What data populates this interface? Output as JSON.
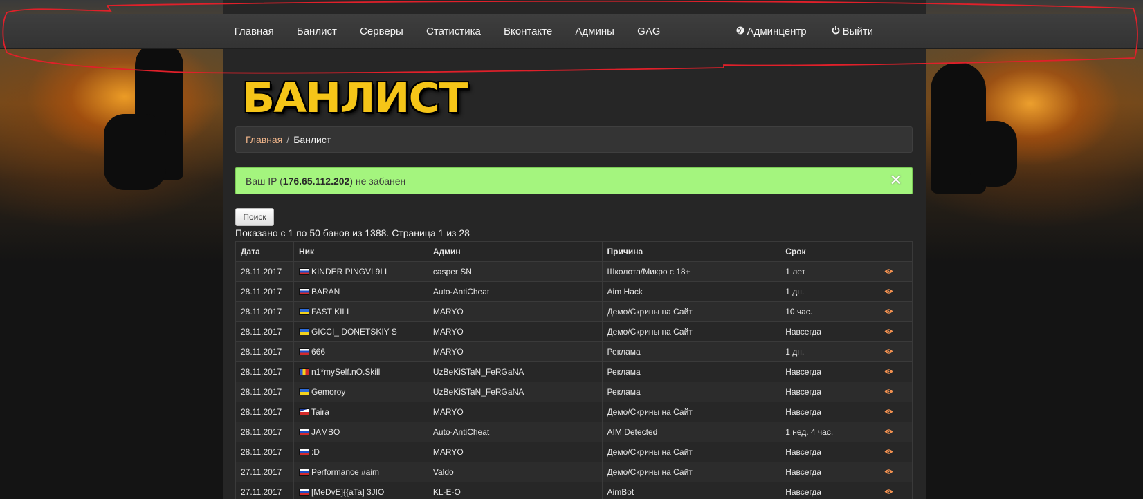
{
  "nav": {
    "links": [
      "Главная",
      "Банлист",
      "Серверы",
      "Статистика",
      "Вконтакте",
      "Админы",
      "GAG"
    ],
    "admin_center": "Админцентр",
    "logout": "Выйти"
  },
  "logo_text": "БАНЛИСТ",
  "breadcrumb": {
    "home": "Главная",
    "separator": "/",
    "current": "Банлист"
  },
  "alert": {
    "prefix": "Ваш IP (",
    "ip": "176.65.112.202",
    "suffix": ") не забанен",
    "close": "✕"
  },
  "search_button": "Поиск",
  "summary": "Показано с 1 по 50 банов из 1388. Страница 1 из 28",
  "table": {
    "headers": [
      "Дата",
      "Ник",
      "Админ",
      "Причина",
      "Срок",
      ""
    ],
    "rows": [
      {
        "date": "28.11.2017",
        "flag": "ru",
        "nick": "KINDER PINGVI 9I L",
        "admin": "casper SN",
        "reason": "Школота/Микро с 18+",
        "term": "1 лет"
      },
      {
        "date": "28.11.2017",
        "flag": "ru",
        "nick": "BARAN",
        "admin": "Auto-AntiCheat",
        "reason": "Aim Hack",
        "term": "1 дн."
      },
      {
        "date": "28.11.2017",
        "flag": "ua",
        "nick": "FAST KILL",
        "admin": "MARYO",
        "reason": "Демо/Скрины на Сайт",
        "term": "10 час."
      },
      {
        "date": "28.11.2017",
        "flag": "ua",
        "nick": "GICCI_ DONETSKIY S",
        "admin": "MARYO",
        "reason": "Демо/Скрины на Сайт",
        "term": "Навсегда"
      },
      {
        "date": "28.11.2017",
        "flag": "ru",
        "nick": "666",
        "admin": "MARYO",
        "reason": "Реклама",
        "term": "1 дн."
      },
      {
        "date": "28.11.2017",
        "flag": "md",
        "nick": "n1*mySelf.nO.Skill",
        "admin": "UzBeKiSTaN_FeRGaNA",
        "reason": "Реклама",
        "term": "Навсегда"
      },
      {
        "date": "28.11.2017",
        "flag": "ua",
        "nick": "Gemoroy",
        "admin": "UzBeKiSTaN_FeRGaNA",
        "reason": "Реклама",
        "term": "Навсегда"
      },
      {
        "date": "28.11.2017",
        "flag": "cz",
        "nick": "Taira",
        "admin": "MARYO",
        "reason": "Демо/Скрины на Сайт",
        "term": "Навсегда"
      },
      {
        "date": "28.11.2017",
        "flag": "ru",
        "nick": "JAMBO",
        "admin": "Auto-AntiCheat",
        "reason": "AIM Detected",
        "term": "1 нед. 4 час."
      },
      {
        "date": "28.11.2017",
        "flag": "ru",
        "nick": ":D",
        "admin": "MARYO",
        "reason": "Демо/Скрины на Сайт",
        "term": "Навсегда"
      },
      {
        "date": "27.11.2017",
        "flag": "ru",
        "nick": "Performance #aim",
        "admin": "Valdo",
        "reason": "Демо/Скрины на Сайт",
        "term": "Навсегда"
      },
      {
        "date": "27.11.2017",
        "flag": "ru",
        "nick": "[MeDvE]{{aTa] 3JIO",
        "admin": "KL-E-O",
        "reason": "AimBot",
        "term": "Навсегда"
      }
    ]
  },
  "icons": {
    "admin_center": "globe-icon",
    "logout": "power-icon",
    "view": "eye-icon"
  },
  "colors": {
    "alert_bg": "#a4f57e",
    "logo": "#f5c518",
    "crumb_link": "#f0b58a",
    "annotation": "#e0202a"
  }
}
